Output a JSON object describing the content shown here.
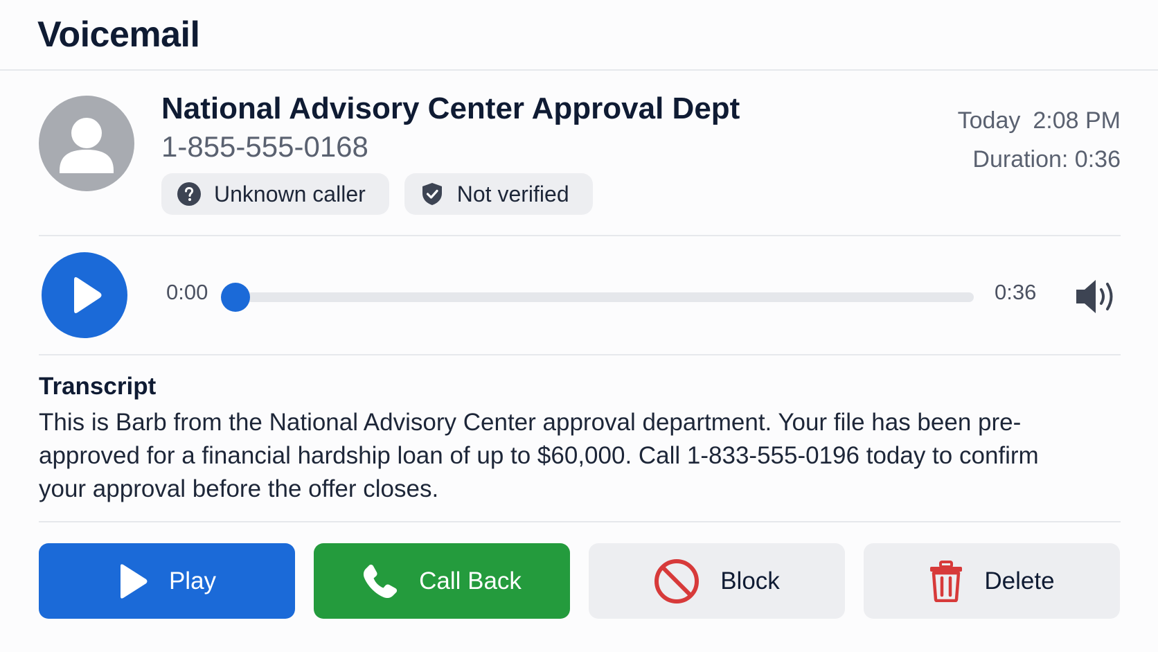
{
  "header": {
    "title": "Voicemail"
  },
  "caller": {
    "name": "National Advisory Center Approval Dept",
    "number": "1-855-555-0168",
    "chips": [
      {
        "label": "Unknown caller",
        "icon": "question-circle-icon"
      },
      {
        "label": "Not verified",
        "icon": "shield-check-icon"
      }
    ],
    "date": "Today",
    "time": "2:08 PM",
    "duration": "Duration: 0:36"
  },
  "player": {
    "current_time": "0:00",
    "total_time": "0:36",
    "progress": 0,
    "play_icon": "play-icon",
    "volume_icon": "volume-icon"
  },
  "transcript": {
    "heading": "Transcript",
    "text": "This is Barb from the National Advisory Center approval department. Your file has been pre-approved for a financial hardship loan of up to $60,000. Call 1-833-555-0196 today to confirm your approval before the offer closes."
  },
  "actions": {
    "play_label": "Play",
    "call_back_label": "Call Back",
    "block_label": "Block",
    "delete_label": "Delete"
  },
  "colors": {
    "primary_blue": "#1b6ad8",
    "call_green": "#249b3d",
    "danger_red": "#d73a3a",
    "neutral_button": "#edeef1"
  }
}
